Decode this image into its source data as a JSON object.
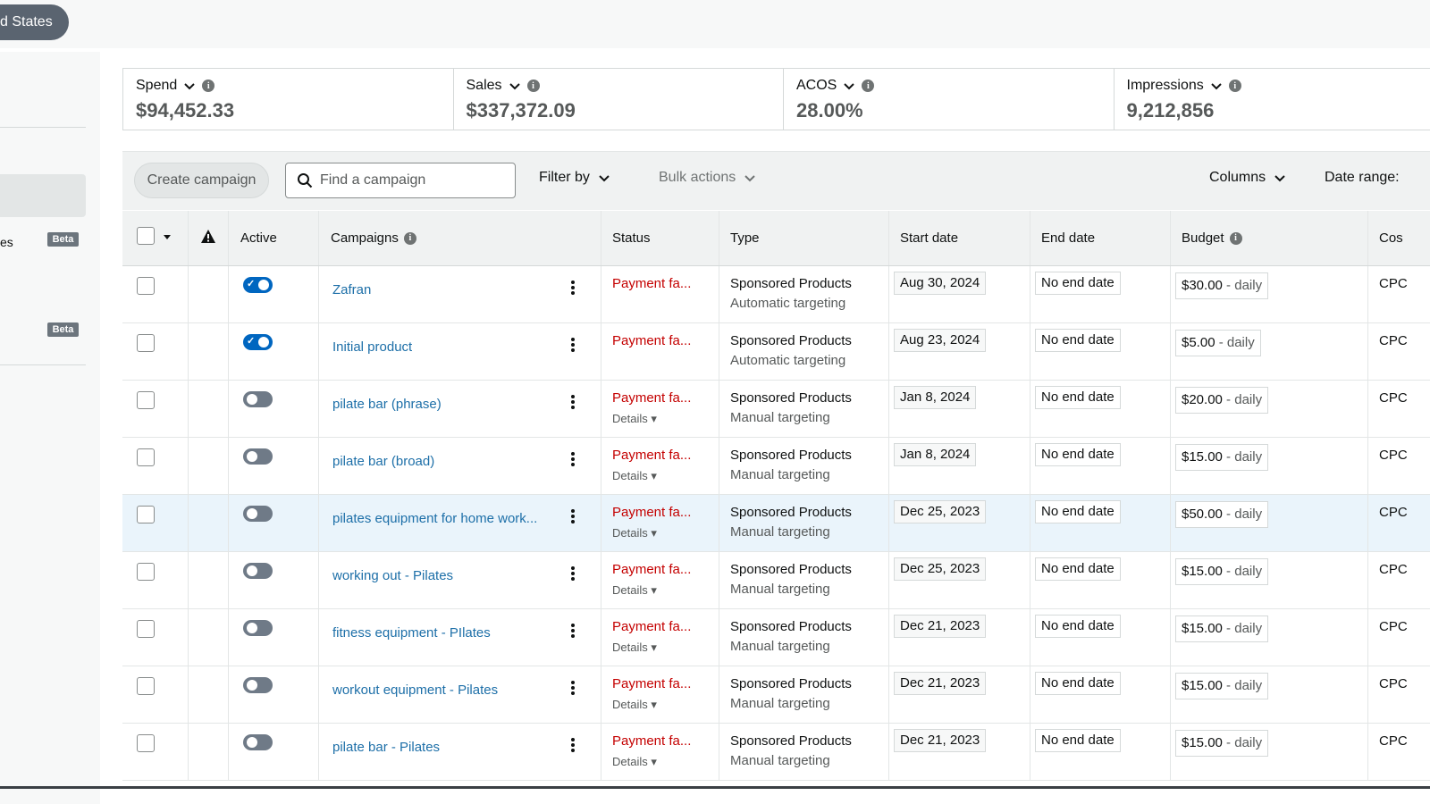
{
  "header": {
    "country_label": "d States"
  },
  "sidebar": {
    "items": [
      {
        "label": "es",
        "badge": "Beta"
      },
      {
        "badge": "Beta"
      }
    ]
  },
  "metrics": [
    {
      "label": "Spend",
      "value": "$94,452.33"
    },
    {
      "label": "Sales",
      "value": "$337,372.09"
    },
    {
      "label": "ACOS",
      "value": "28.00%"
    },
    {
      "label": "Impressions",
      "value": "9,212,856"
    }
  ],
  "toolbar": {
    "create_label": "Create campaign",
    "search_placeholder": "Find a campaign",
    "filter_label": "Filter by",
    "bulk_label": "Bulk actions",
    "columns_label": "Columns",
    "daterange_label": "Date range:"
  },
  "table": {
    "headers": {
      "active": "Active",
      "campaigns": "Campaigns",
      "status": "Status",
      "type": "Type",
      "start": "Start date",
      "end": "End date",
      "budget": "Budget",
      "cost": "Cos"
    },
    "rows": [
      {
        "active": true,
        "name": "Zafran",
        "status": "Payment fa...",
        "details": "",
        "type": "Sponsored Products",
        "targeting": "Automatic targeting",
        "start": "Aug 30, 2024",
        "end": "No end date",
        "budget": "$30.00",
        "budget_suffix": " - daily",
        "cost": "CPC"
      },
      {
        "active": true,
        "name": "Initial product",
        "status": "Payment fa...",
        "details": "",
        "type": "Sponsored Products",
        "targeting": "Automatic targeting",
        "start": "Aug 23, 2024",
        "end": "No end date",
        "budget": "$5.00",
        "budget_suffix": " - daily",
        "cost": "CPC"
      },
      {
        "active": false,
        "name": "pilate bar (phrase)",
        "status": "Payment fa...",
        "details": "Details",
        "type": "Sponsored Products",
        "targeting": "Manual targeting",
        "start": "Jan 8, 2024",
        "end": "No end date",
        "budget": "$20.00",
        "budget_suffix": " - daily",
        "cost": "CPC"
      },
      {
        "active": false,
        "name": "pilate bar (broad)",
        "status": "Payment fa...",
        "details": "Details",
        "type": "Sponsored Products",
        "targeting": "Manual targeting",
        "start": "Jan 8, 2024",
        "end": "No end date",
        "budget": "$15.00",
        "budget_suffix": " - daily",
        "cost": "CPC"
      },
      {
        "active": false,
        "name": "pilates equipment for home work...",
        "status": "Payment fa...",
        "details": "Details",
        "type": "Sponsored Products",
        "targeting": "Manual targeting",
        "start": "Dec 25, 2023",
        "end": "No end date",
        "budget": "$50.00",
        "budget_suffix": " - daily",
        "cost": "CPC",
        "highlight": true
      },
      {
        "active": false,
        "name": "working out - Pilates",
        "status": "Payment fa...",
        "details": "Details",
        "type": "Sponsored Products",
        "targeting": "Manual targeting",
        "start": "Dec 25, 2023",
        "end": "No end date",
        "budget": "$15.00",
        "budget_suffix": " - daily",
        "cost": "CPC"
      },
      {
        "active": false,
        "name": "fitness equipment - PIlates",
        "status": "Payment fa...",
        "details": "Details",
        "type": "Sponsored Products",
        "targeting": "Manual targeting",
        "start": "Dec 21, 2023",
        "end": "No end date",
        "budget": "$15.00",
        "budget_suffix": " - daily",
        "cost": "CPC"
      },
      {
        "active": false,
        "name": "workout equipment - Pilates",
        "status": "Payment fa...",
        "details": "Details",
        "type": "Sponsored Products",
        "targeting": "Manual targeting",
        "start": "Dec 21, 2023",
        "end": "No end date",
        "budget": "$15.00",
        "budget_suffix": " - daily",
        "cost": "CPC"
      },
      {
        "active": false,
        "name": "pilate bar - Pilates",
        "status": "Payment fa...",
        "details": "Details",
        "type": "Sponsored Products",
        "targeting": "Manual targeting",
        "start": "Dec 21, 2023",
        "end": "No end date",
        "budget": "$15.00",
        "budget_suffix": " - daily",
        "cost": "CPC"
      }
    ]
  },
  "colors": {
    "link": "#1d6fa8",
    "error": "#c40000",
    "toggle_on": "#0066c0",
    "toggle_off": "#6f7a87",
    "highlight_row": "#eaf4fb"
  },
  "icons": {
    "search": "search-icon",
    "chevron": "chevron-down-icon",
    "info": "info-icon",
    "warning": "warning-icon",
    "kebab": "kebab-icon"
  }
}
